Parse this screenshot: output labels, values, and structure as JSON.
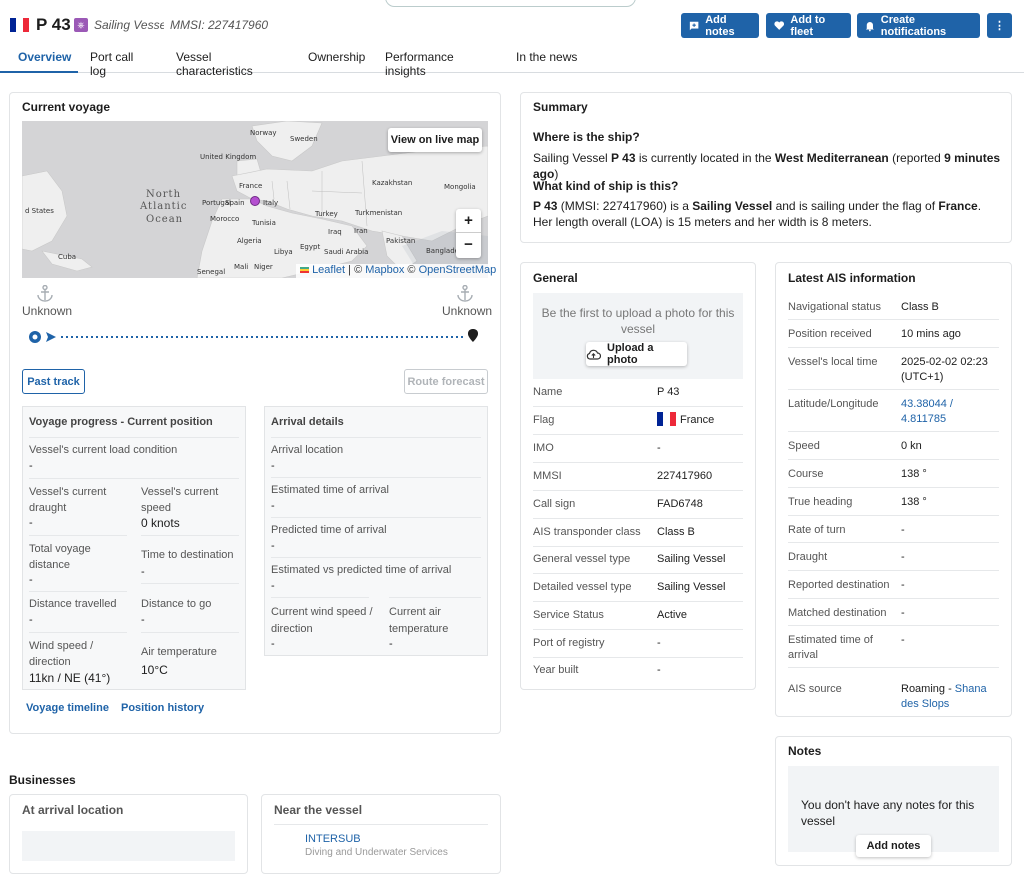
{
  "header": {
    "flag_colors": [
      "#002395",
      "#ffffff",
      "#ed2939"
    ],
    "vessel_name": "P 43",
    "vessel_type_italic": "Sailing Vessel",
    "mmsi_italic": "MMSI: 227417960",
    "buttons": {
      "add_notes": "Add notes",
      "add_to_fleet": "Add to fleet",
      "create_notifications": "Create notifications",
      "more": "⋮"
    }
  },
  "tabs": [
    "Overview",
    "Port call log",
    "Vessel characteristics",
    "Ownership",
    "Performance insights",
    "In the news"
  ],
  "current_voyage": {
    "title": "Current voyage",
    "map_button": "View on live map",
    "zoom_in": "+",
    "zoom_out": "−",
    "attribution": {
      "leaflet": "Leaflet",
      "sep1": " | © ",
      "mapbox": "Mapbox",
      "sep2": " © ",
      "osm": "OpenStreetMap"
    },
    "map_labels": [
      "Norway",
      "Sweden",
      "United Kingdom",
      "North",
      "Atlantic",
      "Ocean",
      "France",
      "Spain",
      "Italy",
      "Portugal",
      "Morocco",
      "Algeria",
      "Libya",
      "Egypt",
      "Tunisia",
      "Mali",
      "Niger",
      "Senegal",
      "Cuba",
      "d States",
      "Kazakhstan",
      "Mongolia",
      "Turkey",
      "Turkmenistan",
      "Iraq",
      "Iran",
      "Pakistan",
      "Saudi Arabia",
      "Bangladesh"
    ],
    "departure": "Unknown",
    "arrival": "Unknown",
    "past_track": "Past track",
    "route_forecast": "Route forecast",
    "progress": {
      "title": "Voyage progress - Current position",
      "load_condition_label": "Vessel's current load condition",
      "load_condition_value": "-",
      "draught_label": "Vessel's current draught",
      "draught_value": "-",
      "speed_label": "Vessel's current speed",
      "speed_value": "0 knots",
      "total_distance_label": "Total voyage distance",
      "total_distance_value": "-",
      "time_to_dest_label": "Time to destination",
      "time_to_dest_value": "-",
      "distance_travelled_label": "Distance travelled",
      "distance_travelled_value": "-",
      "distance_to_go_label": "Distance to go",
      "distance_to_go_value": "-",
      "wind_label": "Wind speed / direction",
      "wind_value": "11kn / NE (41°)",
      "air_temp_label": "Air temperature",
      "air_temp_value": "10°C"
    },
    "arrival_details": {
      "title": "Arrival details",
      "location_label": "Arrival location",
      "location_value": "-",
      "eta_label": "Estimated time of arrival",
      "eta_value": "-",
      "pta_label": "Predicted time of arrival",
      "pta_value": "-",
      "evp_label": "Estimated vs predicted time of arrival",
      "evp_value": "-",
      "wind_label": "Current wind speed / direction",
      "wind_value": "-",
      "air_label": "Current air temperature",
      "air_value": "-"
    },
    "links": {
      "timeline": "Voyage timeline",
      "history": "Position history"
    }
  },
  "summary": {
    "title": "Summary",
    "q1": "Where is the ship?",
    "a1": {
      "p1": "Sailing Vessel ",
      "name": "P 43",
      "p2": " is currently located in the ",
      "area": "West Mediterranean",
      "p3": " (reported ",
      "time": "9 minutes ago",
      "p4": ")"
    },
    "q2": "What kind of ship is this?",
    "a2": {
      "name": "P 43",
      "p1": " (MMSI: 227417960) is a ",
      "type": "Sailing Vessel",
      "p2": " and is sailing under the flag of ",
      "flag": "France",
      "p3": ". Her length overall (LOA) is 15 meters and her width is 8 meters."
    }
  },
  "general": {
    "title": "General",
    "photo_text": "Be the first to upload a photo for this vessel",
    "upload_button": "Upload a photo",
    "rows": [
      {
        "label": "Name",
        "value": "P 43"
      },
      {
        "label": "Flag",
        "value": "France"
      },
      {
        "label": "IMO",
        "value": "-"
      },
      {
        "label": "MMSI",
        "value": "227417960"
      },
      {
        "label": "Call sign",
        "value": "FAD6748"
      },
      {
        "label": "AIS transponder class",
        "value": "Class B"
      },
      {
        "label": "General vessel type",
        "value": "Sailing Vessel"
      },
      {
        "label": "Detailed vessel type",
        "value": "Sailing Vessel"
      },
      {
        "label": "Service Status",
        "value": "Active"
      },
      {
        "label": "Port of registry",
        "value": "-"
      },
      {
        "label": "Year built",
        "value": "-"
      }
    ]
  },
  "ais": {
    "title": "Latest AIS information",
    "rows": [
      {
        "label": "Navigational status",
        "value": "Class B"
      },
      {
        "label": "Position received",
        "value": "10 mins ago"
      },
      {
        "label": "Vessel's local time",
        "value": "2025-02-02 02:23 (UTC+1)"
      },
      {
        "label": "Latitude/Longitude",
        "value": "43.38044 / 4.811785"
      },
      {
        "label": "Speed",
        "value": "0 kn"
      },
      {
        "label": "Course",
        "value": "138 °"
      },
      {
        "label": "True heading",
        "value": "138 °"
      },
      {
        "label": "Rate of turn",
        "value": "-"
      },
      {
        "label": "Draught",
        "value": "-"
      },
      {
        "label": "Reported destination",
        "value": "-"
      },
      {
        "label": "Matched destination",
        "value": "-"
      },
      {
        "label": "Estimated time of arrival",
        "value": "-"
      },
      {
        "label": "AIS source",
        "value": "Roaming - ",
        "link": "Shana des Slops"
      }
    ]
  },
  "notes": {
    "title": "Notes",
    "text": "You don't have any notes for this vessel",
    "button": "Add notes"
  },
  "businesses": {
    "title": "Businesses",
    "arrival_title": "At arrival location",
    "near_title": "Near the vessel",
    "near_item": "INTERSUB",
    "near_item_sub": "Diving and Underwater Services"
  }
}
